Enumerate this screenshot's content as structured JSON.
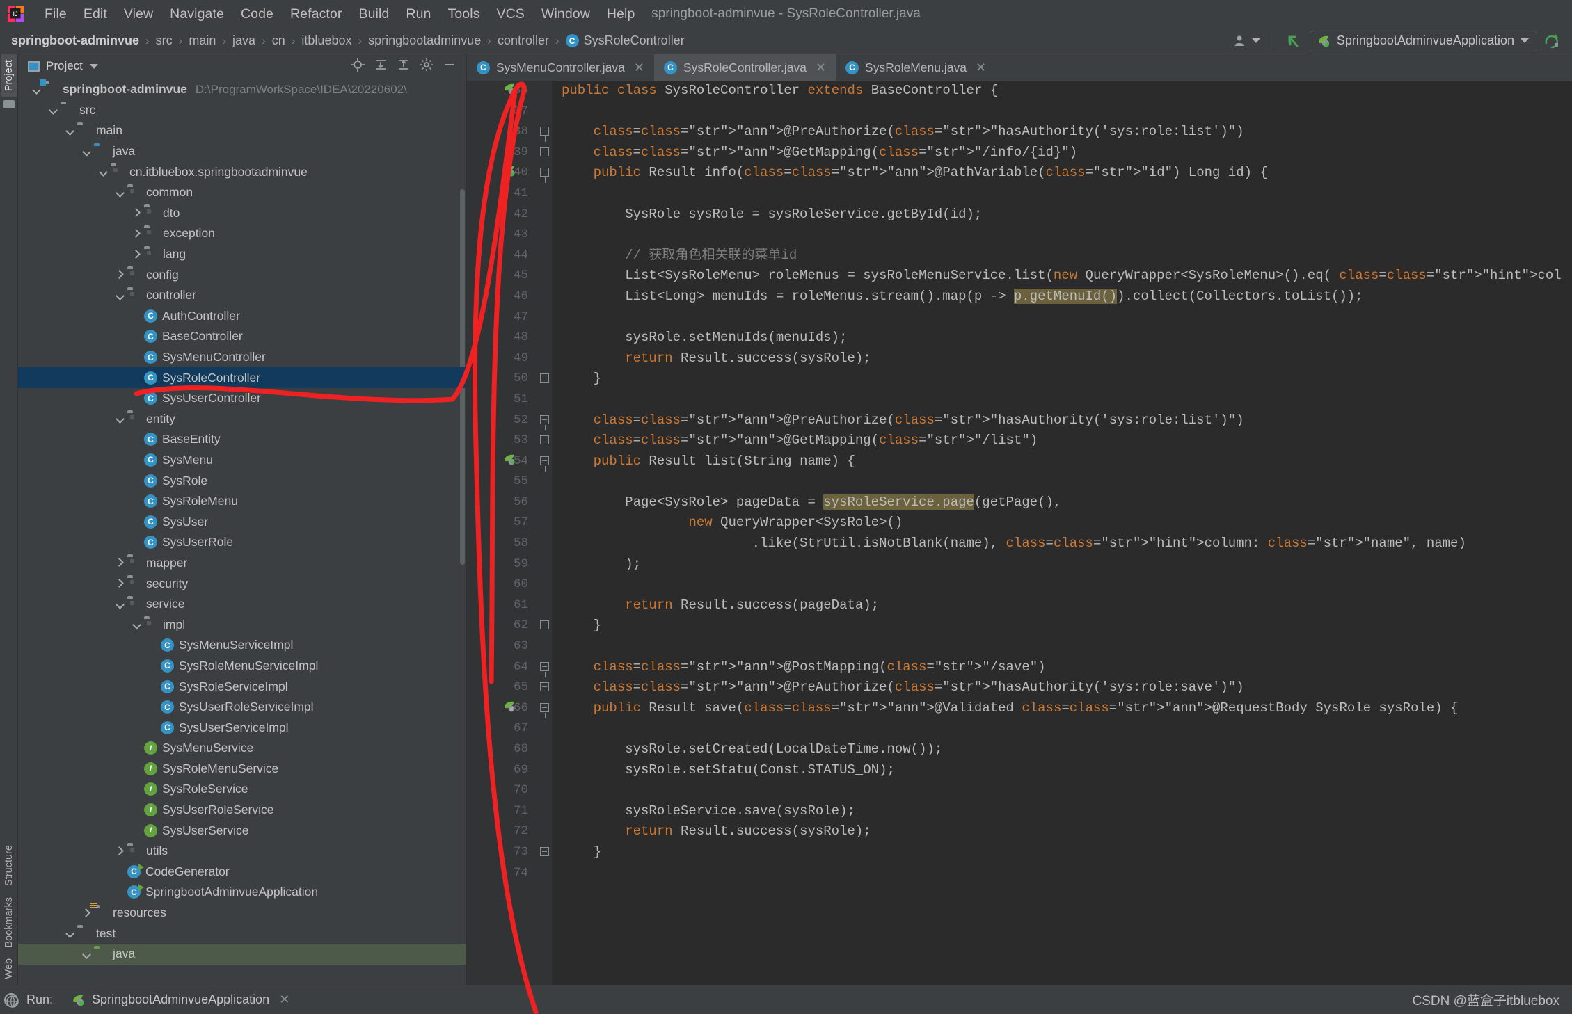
{
  "window": {
    "title": "springboot-adminvue - SysRoleController.java"
  },
  "menubar": {
    "items": [
      {
        "label": "File",
        "mnemonic": "F"
      },
      {
        "label": "Edit",
        "mnemonic": "E"
      },
      {
        "label": "View",
        "mnemonic": "V"
      },
      {
        "label": "Navigate",
        "mnemonic": "N"
      },
      {
        "label": "Code",
        "mnemonic": "C"
      },
      {
        "label": "Refactor",
        "mnemonic": "R"
      },
      {
        "label": "Build",
        "mnemonic": "B"
      },
      {
        "label": "Run",
        "mnemonic": "u"
      },
      {
        "label": "Tools",
        "mnemonic": "T"
      },
      {
        "label": "VCS",
        "mnemonic": "S"
      },
      {
        "label": "Window",
        "mnemonic": "W"
      },
      {
        "label": "Help",
        "mnemonic": "H"
      }
    ]
  },
  "breadcrumb": {
    "items": [
      "springboot-adminvue",
      "src",
      "main",
      "java",
      "cn",
      "itbluebox",
      "springbootadminvue",
      "controller"
    ],
    "current_file": "SysRoleController",
    "current_file_icon": "class-icon"
  },
  "run_config": {
    "name": "SpringbootAdminvueApplication",
    "icon": "spring-boot-icon",
    "dropdown_icon": "chevron-down-icon",
    "rerun_icon": "rerun-icon",
    "back_icon": "back-arrow-icon",
    "user_icon": "user-icon"
  },
  "tool_strip": {
    "left_top": [
      "Project"
    ],
    "left_bottom": [
      "Structure",
      "Bookmarks",
      "Web"
    ]
  },
  "project_panel": {
    "title": "Project",
    "dropdown_icon": "chevron-down-icon",
    "toolbar_icons": [
      "locate-icon",
      "expand-all-icon",
      "collapse-all-icon",
      "settings-icon",
      "hide-icon"
    ],
    "tree": [
      {
        "label": "springboot-adminvue",
        "sub": "D:\\ProgramWorkSpace\\IDEA\\20220602\\",
        "depth": 0,
        "arrow": "down",
        "icon": "module-folder",
        "bold": true
      },
      {
        "label": "src",
        "depth": 1,
        "arrow": "down",
        "icon": "folder"
      },
      {
        "label": "main",
        "depth": 2,
        "arrow": "down",
        "icon": "folder"
      },
      {
        "label": "java",
        "depth": 3,
        "arrow": "down",
        "icon": "source-folder"
      },
      {
        "label": "cn.itbluebox.springbootadminvue",
        "depth": 4,
        "arrow": "down",
        "icon": "package"
      },
      {
        "label": "common",
        "depth": 5,
        "arrow": "down",
        "icon": "package"
      },
      {
        "label": "dto",
        "depth": 6,
        "arrow": "right",
        "icon": "package"
      },
      {
        "label": "exception",
        "depth": 6,
        "arrow": "right",
        "icon": "package"
      },
      {
        "label": "lang",
        "depth": 6,
        "arrow": "right",
        "icon": "package"
      },
      {
        "label": "config",
        "depth": 5,
        "arrow": "right",
        "icon": "package"
      },
      {
        "label": "controller",
        "depth": 5,
        "arrow": "down",
        "icon": "package"
      },
      {
        "label": "AuthController",
        "depth": 6,
        "arrow": "none",
        "icon": "class"
      },
      {
        "label": "BaseController",
        "depth": 6,
        "arrow": "none",
        "icon": "class"
      },
      {
        "label": "SysMenuController",
        "depth": 6,
        "arrow": "none",
        "icon": "class"
      },
      {
        "label": "SysRoleController",
        "depth": 6,
        "arrow": "none",
        "icon": "class",
        "selected": true
      },
      {
        "label": "SysUserController",
        "depth": 6,
        "arrow": "none",
        "icon": "class"
      },
      {
        "label": "entity",
        "depth": 5,
        "arrow": "down",
        "icon": "package"
      },
      {
        "label": "BaseEntity",
        "depth": 6,
        "arrow": "none",
        "icon": "class"
      },
      {
        "label": "SysMenu",
        "depth": 6,
        "arrow": "none",
        "icon": "class"
      },
      {
        "label": "SysRole",
        "depth": 6,
        "arrow": "none",
        "icon": "class"
      },
      {
        "label": "SysRoleMenu",
        "depth": 6,
        "arrow": "none",
        "icon": "class"
      },
      {
        "label": "SysUser",
        "depth": 6,
        "arrow": "none",
        "icon": "class"
      },
      {
        "label": "SysUserRole",
        "depth": 6,
        "arrow": "none",
        "icon": "class"
      },
      {
        "label": "mapper",
        "depth": 5,
        "arrow": "right",
        "icon": "package"
      },
      {
        "label": "security",
        "depth": 5,
        "arrow": "right",
        "icon": "package"
      },
      {
        "label": "service",
        "depth": 5,
        "arrow": "down",
        "icon": "package"
      },
      {
        "label": "impl",
        "depth": 6,
        "arrow": "down",
        "icon": "package"
      },
      {
        "label": "SysMenuServiceImpl",
        "depth": 7,
        "arrow": "none",
        "icon": "class"
      },
      {
        "label": "SysRoleMenuServiceImpl",
        "depth": 7,
        "arrow": "none",
        "icon": "class"
      },
      {
        "label": "SysRoleServiceImpl",
        "depth": 7,
        "arrow": "none",
        "icon": "class"
      },
      {
        "label": "SysUserRoleServiceImpl",
        "depth": 7,
        "arrow": "none",
        "icon": "class"
      },
      {
        "label": "SysUserServiceImpl",
        "depth": 7,
        "arrow": "none",
        "icon": "class"
      },
      {
        "label": "SysMenuService",
        "depth": 6,
        "arrow": "none",
        "icon": "interface"
      },
      {
        "label": "SysRoleMenuService",
        "depth": 6,
        "arrow": "none",
        "icon": "interface"
      },
      {
        "label": "SysRoleService",
        "depth": 6,
        "arrow": "none",
        "icon": "interface"
      },
      {
        "label": "SysUserRoleService",
        "depth": 6,
        "arrow": "none",
        "icon": "interface"
      },
      {
        "label": "SysUserService",
        "depth": 6,
        "arrow": "none",
        "icon": "interface"
      },
      {
        "label": "utils",
        "depth": 5,
        "arrow": "right",
        "icon": "package"
      },
      {
        "label": "CodeGenerator",
        "depth": 5,
        "arrow": "none",
        "icon": "class-runnable"
      },
      {
        "label": "SpringbootAdminvueApplication",
        "depth": 5,
        "arrow": "none",
        "icon": "spring-class-runnable"
      },
      {
        "label": "resources",
        "depth": 3,
        "arrow": "right",
        "icon": "resources-folder"
      },
      {
        "label": "test",
        "depth": 2,
        "arrow": "down",
        "icon": "folder"
      },
      {
        "label": "java",
        "depth": 3,
        "arrow": "down",
        "icon": "test-source-folder",
        "greenbg": true
      }
    ]
  },
  "editor": {
    "tabs": [
      {
        "label": "SysMenuController.java",
        "icon": "class-icon",
        "active": false,
        "close_icon": "close-icon"
      },
      {
        "label": "SysRoleController.java",
        "icon": "class-icon",
        "active": true,
        "close_icon": "close-icon"
      },
      {
        "label": "SysRoleMenu.java",
        "icon": "class-icon",
        "active": false,
        "close_icon": "close-icon"
      }
    ],
    "first_line_number": 36,
    "last_line_number": 74,
    "code_lines": [
      {
        "n": 36,
        "marker": "spring-bean-gutter-icon",
        "fold": null,
        "text": "public class SysRoleController extends BaseController {"
      },
      {
        "n": 37,
        "text": ""
      },
      {
        "n": 38,
        "fold": "collapse",
        "text": "    @PreAuthorize(\"hasAuthority('sys:role:list')\")"
      },
      {
        "n": 39,
        "fold": "collapse-mid",
        "text": "    @GetMapping(\"/info/{id}\")"
      },
      {
        "n": 40,
        "marker": "spring-mapping-gutter-icon",
        "fold": "collapse",
        "text": "    public Result info(@PathVariable(\"id\") Long id) {"
      },
      {
        "n": 41,
        "text": ""
      },
      {
        "n": 42,
        "text": "        SysRole sysRole = sysRoleService.getById(id);"
      },
      {
        "n": 43,
        "text": ""
      },
      {
        "n": 44,
        "text": "        // 获取角色相关联的菜单id"
      },
      {
        "n": 45,
        "text": "        List<SysRoleMenu> roleMenus = sysRoleMenuService.list(new QueryWrapper<SysRoleMenu>().eq( column: \"role_id\", id));"
      },
      {
        "n": 46,
        "text": "        List<Long> menuIds = roleMenus.stream().map(p -> p.getMenuId()).collect(Collectors.toList());"
      },
      {
        "n": 47,
        "text": ""
      },
      {
        "n": 48,
        "text": "        sysRole.setMenuIds(menuIds);"
      },
      {
        "n": 49,
        "text": "        return Result.success(sysRole);"
      },
      {
        "n": 50,
        "fold": "collapse-end",
        "text": "    }"
      },
      {
        "n": 51,
        "text": ""
      },
      {
        "n": 52,
        "fold": "collapse",
        "text": "    @PreAuthorize(\"hasAuthority('sys:role:list')\")"
      },
      {
        "n": 53,
        "fold": "collapse-mid",
        "text": "    @GetMapping(\"/list\")"
      },
      {
        "n": 54,
        "marker": "spring-mapping-gutter-icon",
        "fold": "collapse",
        "text": "    public Result list(String name) {"
      },
      {
        "n": 55,
        "text": ""
      },
      {
        "n": 56,
        "text": "        Page<SysRole> pageData = sysRoleService.page(getPage(),"
      },
      {
        "n": 57,
        "text": "                new QueryWrapper<SysRole>()"
      },
      {
        "n": 58,
        "text": "                        .like(StrUtil.isNotBlank(name), column: \"name\", name)"
      },
      {
        "n": 59,
        "text": "        );"
      },
      {
        "n": 60,
        "text": ""
      },
      {
        "n": 61,
        "text": "        return Result.success(pageData);"
      },
      {
        "n": 62,
        "fold": "collapse-end",
        "text": "    }"
      },
      {
        "n": 63,
        "text": ""
      },
      {
        "n": 64,
        "fold": "collapse",
        "text": "    @PostMapping(\"/save\")"
      },
      {
        "n": 65,
        "fold": "collapse-mid",
        "text": "    @PreAuthorize(\"hasAuthority('sys:role:save')\")"
      },
      {
        "n": 66,
        "marker": "spring-mapping-gutter-icon-at",
        "fold": "collapse",
        "text": "    public Result save(@Validated @RequestBody SysRole sysRole) {"
      },
      {
        "n": 67,
        "text": ""
      },
      {
        "n": 68,
        "text": "        sysRole.setCreated(LocalDateTime.now());"
      },
      {
        "n": 69,
        "text": "        sysRole.setStatu(Const.STATUS_ON);"
      },
      {
        "n": 70,
        "text": ""
      },
      {
        "n": 71,
        "text": "        sysRoleService.save(sysRole);"
      },
      {
        "n": 72,
        "text": "        return Result.success(sysRole);"
      },
      {
        "n": 73,
        "fold": "collapse-end",
        "text": "    }"
      },
      {
        "n": 74,
        "text": ""
      }
    ]
  },
  "bottom": {
    "run_label": "Run:",
    "run_tab": "SpringbootAdminvueApplication",
    "close_icon": "close-icon",
    "spring_icon": "spring-boot-icon",
    "globe_icon": "globe-icon"
  },
  "watermark": {
    "text": "CSDN @蓝盒子itbluebox"
  },
  "annotation": {
    "color": "#ee2222",
    "description": "red-hand-drawn-line"
  },
  "colors": {
    "background": "#3c3f41",
    "editor_background": "#2b2b2b",
    "gutter": "#313335",
    "selection": "#113a5c",
    "accent_blue": "#3592c4",
    "accent_green": "#62a23f",
    "keyword": "#cc7832",
    "string": "#6a8759",
    "annotation": "#bbb529",
    "field": "#9876aa",
    "method": "#ffc66d",
    "comment": "#808080",
    "text": "#a9b7c6"
  }
}
